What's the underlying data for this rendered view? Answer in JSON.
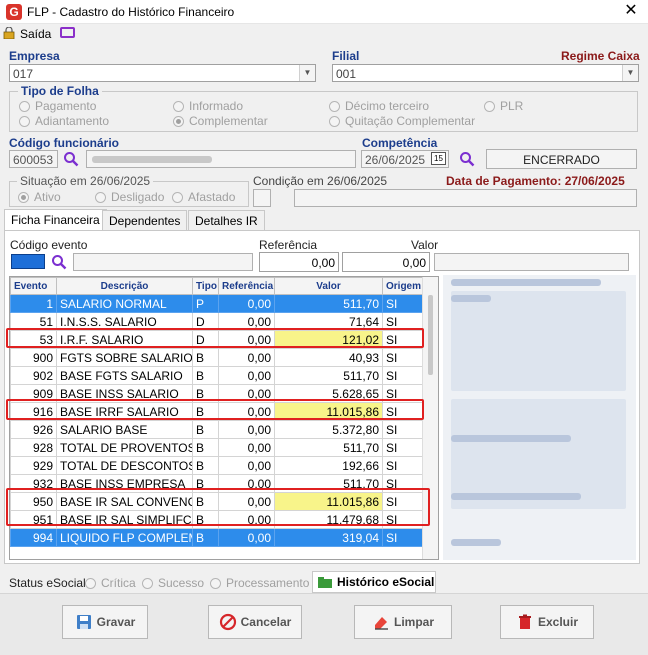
{
  "window": {
    "title": "FLP - Cadastro do Histórico Financeiro",
    "close": "✕"
  },
  "toolbar": {
    "exit_label": "Saída"
  },
  "empresa": {
    "label": "Empresa",
    "value": "017"
  },
  "filial": {
    "label": "Filial",
    "value": "001",
    "regime": "Regime Caixa"
  },
  "tipo_folha": {
    "title": "Tipo de Folha",
    "options": [
      "Pagamento",
      "Informado",
      "Décimo terceiro",
      "PLR",
      "Adiantamento",
      "Complementar",
      "Quitação Complementar"
    ],
    "selected": "Complementar"
  },
  "funcionario": {
    "label": "Código funcionário",
    "code": "600053"
  },
  "competencia": {
    "label": "Competência",
    "date": "26/06/2025",
    "calendar": "15",
    "status": "ENCERRADO"
  },
  "situacao": {
    "title": "Situação em  26/06/2025",
    "options": [
      "Ativo",
      "Desligado",
      "Afastado"
    ],
    "selected": "Ativo"
  },
  "condicao": {
    "title": "Condição em 26/06/2025"
  },
  "pagamento": {
    "label": "Data de Pagamento: 27/06/2025"
  },
  "tabs": [
    "Ficha Financeira",
    "Dependentes",
    "Detalhes IR"
  ],
  "entry": {
    "evento_label": "Código evento",
    "referencia_label": "Referência",
    "valor_label": "Valor",
    "referencia": "0,00",
    "valor": "0,00"
  },
  "grid": {
    "columns": [
      "Evento",
      "Descrição",
      "Tipo",
      "Referência",
      "Valor",
      "Origem"
    ],
    "rows": [
      {
        "evento": "1",
        "descricao": "SALARIO NORMAL",
        "tipo": "P",
        "referencia": "0,00",
        "valor": "511,70",
        "origem": "SI"
      },
      {
        "evento": "51",
        "descricao": "I.N.S.S. SALARIO",
        "tipo": "D",
        "referencia": "0,00",
        "valor": "71,64",
        "origem": "SI"
      },
      {
        "evento": "53",
        "descricao": "I.R.F. SALARIO",
        "tipo": "D",
        "referencia": "0,00",
        "valor": "121,02",
        "origem": "SI"
      },
      {
        "evento": "900",
        "descricao": "FGTS SOBRE SALARIO",
        "tipo": "B",
        "referencia": "0,00",
        "valor": "40,93",
        "origem": "SI"
      },
      {
        "evento": "902",
        "descricao": "BASE FGTS SALARIO",
        "tipo": "B",
        "referencia": "0,00",
        "valor": "511,70",
        "origem": "SI"
      },
      {
        "evento": "909",
        "descricao": "BASE INSS SALARIO",
        "tipo": "B",
        "referencia": "0,00",
        "valor": "5.628,65",
        "origem": "SI"
      },
      {
        "evento": "916",
        "descricao": "BASE IRRF SALARIO",
        "tipo": "B",
        "referencia": "0,00",
        "valor": "11.015,86",
        "origem": "SI"
      },
      {
        "evento": "926",
        "descricao": "SALARIO BASE",
        "tipo": "B",
        "referencia": "0,00",
        "valor": "5.372,80",
        "origem": "SI"
      },
      {
        "evento": "928",
        "descricao": "TOTAL DE PROVENTOS",
        "tipo": "B",
        "referencia": "0,00",
        "valor": "511,70",
        "origem": "SI"
      },
      {
        "evento": "929",
        "descricao": "TOTAL DE DESCONTOS",
        "tipo": "B",
        "referencia": "0,00",
        "valor": "192,66",
        "origem": "SI"
      },
      {
        "evento": "932",
        "descricao": "BASE INSS EMPRESA",
        "tipo": "B",
        "referencia": "0,00",
        "valor": "511,70",
        "origem": "SI"
      },
      {
        "evento": "950",
        "descricao": "BASE IR SAL CONVENCI...",
        "tipo": "B",
        "referencia": "0,00",
        "valor": "11.015,86",
        "origem": "SI"
      },
      {
        "evento": "951",
        "descricao": "BASE IR SAL SIMPLIFCAD",
        "tipo": "B",
        "referencia": "0,00",
        "valor": "11.479,68",
        "origem": "SI"
      },
      {
        "evento": "994",
        "descricao": "LIQUIDO FLP COMPLEM...",
        "tipo": "B",
        "referencia": "0,00",
        "valor": "319,04",
        "origem": "SI"
      }
    ]
  },
  "esocial": {
    "label": "Status eSocial:",
    "options": [
      "Crítica",
      "Sucesso",
      "Processamento"
    ],
    "history_button": "Histórico eSocial"
  },
  "buttons": {
    "save": "Gravar",
    "cancel": "Cancelar",
    "clear": "Limpar",
    "delete": "Excluir"
  },
  "colors": {
    "selected_row": "#2d8ceb",
    "highlight": "#f8f48a",
    "red_box": "#e02020",
    "label_blue": "#1c3d8c"
  }
}
